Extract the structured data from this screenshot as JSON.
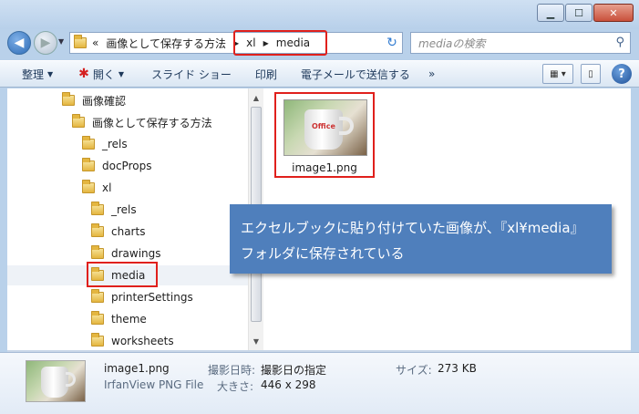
{
  "window": {
    "controls": {
      "minimize": "▁",
      "maximize": "☐",
      "close": "✕"
    }
  },
  "address": {
    "prefix": "«",
    "crumbs": [
      "画像として保存する方法",
      "xl",
      "media"
    ],
    "search_placeholder": "mediaの検索"
  },
  "toolbar": {
    "organize": "整理",
    "open": "開く",
    "slideshow": "スライド ショー",
    "print": "印刷",
    "email": "電子メールで送信する",
    "more": "»"
  },
  "tree": [
    {
      "label": "画像確認",
      "indent": 0
    },
    {
      "label": "画像として保存する方法",
      "indent": 1
    },
    {
      "label": "_rels",
      "indent": 2
    },
    {
      "label": "docProps",
      "indent": 2
    },
    {
      "label": "xl",
      "indent": 2
    },
    {
      "label": "_rels",
      "indent": 3
    },
    {
      "label": "charts",
      "indent": 3
    },
    {
      "label": "drawings",
      "indent": 3
    },
    {
      "label": "media",
      "indent": 3
    },
    {
      "label": "printerSettings",
      "indent": 3
    },
    {
      "label": "theme",
      "indent": 3
    },
    {
      "label": "worksheets",
      "indent": 3
    }
  ],
  "files": [
    {
      "name": "image1.png",
      "logo_text": "Office"
    }
  ],
  "callout": {
    "line1": "エクセルブックに貼り付けていた画像が、『xl¥media』",
    "line2": "フォルダに保存されている"
  },
  "details": {
    "file_name": "image1.png",
    "file_type": "IrfanView PNG File",
    "date_label": "撮影日時:",
    "date_value": "撮影日の指定",
    "dimensions_label": "大きさ:",
    "dimensions_value": "446 x 298",
    "size_label": "サイズ:",
    "size_value": "273 KB"
  }
}
